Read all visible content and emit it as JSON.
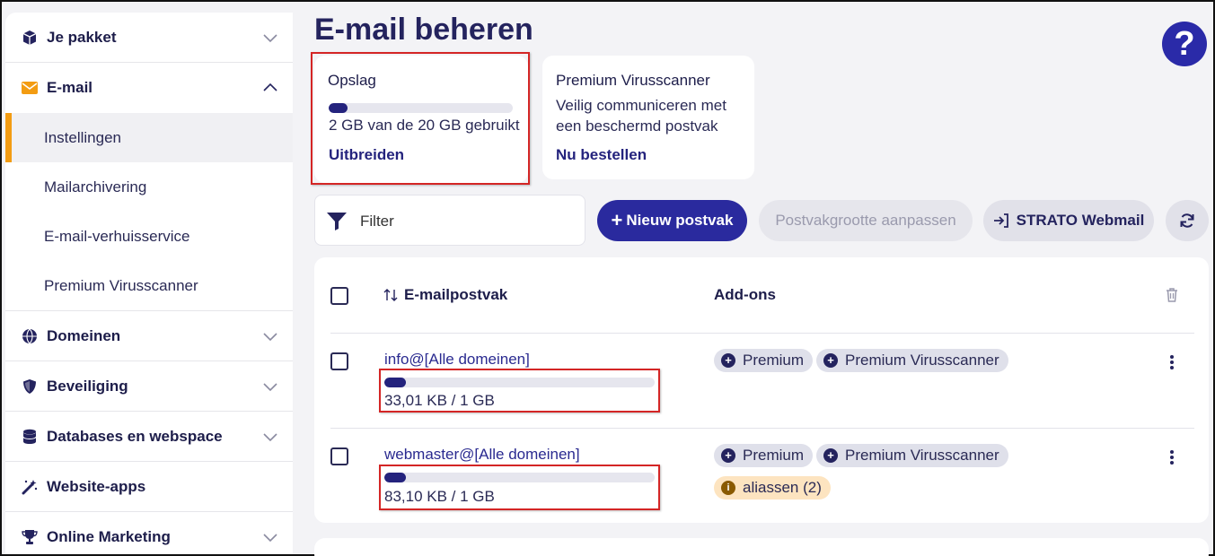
{
  "sidebar": {
    "items": [
      {
        "label": "Je pakket",
        "icon": "box-icon"
      },
      {
        "label": "E-mail",
        "icon": "envelope-icon"
      },
      {
        "label": "Domeinen",
        "icon": "globe-icon"
      },
      {
        "label": "Beveiliging",
        "icon": "shield-icon"
      },
      {
        "label": "Databases en webspace",
        "icon": "database-icon"
      },
      {
        "label": "Website-apps",
        "icon": "magic-wand-icon"
      },
      {
        "label": "Online Marketing",
        "icon": "trophy-icon"
      }
    ],
    "email_sub": [
      "Instellingen",
      "Mailarchivering",
      "E-mail-verhuisservice",
      "Premium Virusscanner"
    ]
  },
  "header": {
    "title": "E-mail beheren",
    "help": "?"
  },
  "storage_card": {
    "title": "Opslag",
    "usage_text": "2 GB van de 20 GB gebruikt",
    "usage_fraction": 0.1,
    "link": "Uitbreiden"
  },
  "virus_card": {
    "title": "Premium Virusscanner",
    "line1": "Veilig communiceren met",
    "line2": "een beschermd postvak",
    "link": "Nu bestellen"
  },
  "toolbar": {
    "filter_placeholder": "Filter",
    "new_mailbox": "Nieuw postvak",
    "resize_mailbox": "Postvakgrootte aanpassen",
    "webmail": "STRATO Webmail"
  },
  "table": {
    "col_email": "E-mailpostvak",
    "col_addons": "Add-ons",
    "rows": [
      {
        "email": "info@[Alle domeinen]",
        "usage": "33,01 KB / 1 GB",
        "addons": [
          "Premium",
          "Premium Virusscanner"
        ],
        "alias": ""
      },
      {
        "email": "webmaster@[Alle domeinen]",
        "usage": "83,10 KB / 1 GB",
        "addons": [
          "Premium",
          "Premium Virusscanner"
        ],
        "alias": "aliassen (2)"
      }
    ]
  },
  "colors": {
    "accent": "#f39c12",
    "primary": "#2a2a9e",
    "highlight": "#d42525"
  }
}
